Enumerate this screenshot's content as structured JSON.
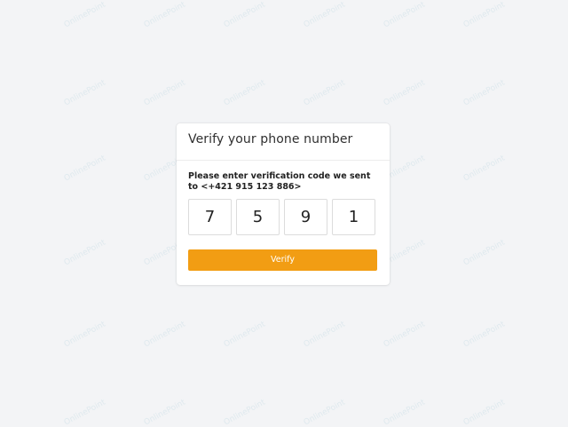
{
  "card": {
    "title": "Verify your phone number",
    "instruction": "Please enter verification code we sent to <+421 915 123 886>",
    "code_digits": [
      "7",
      "5",
      "9",
      "1"
    ],
    "verify_label": "Verify"
  },
  "watermark": {
    "text": "OnlinePoint"
  },
  "colors": {
    "background": "#f3f4f6",
    "card": "#ffffff",
    "accent": "#f29d13"
  }
}
